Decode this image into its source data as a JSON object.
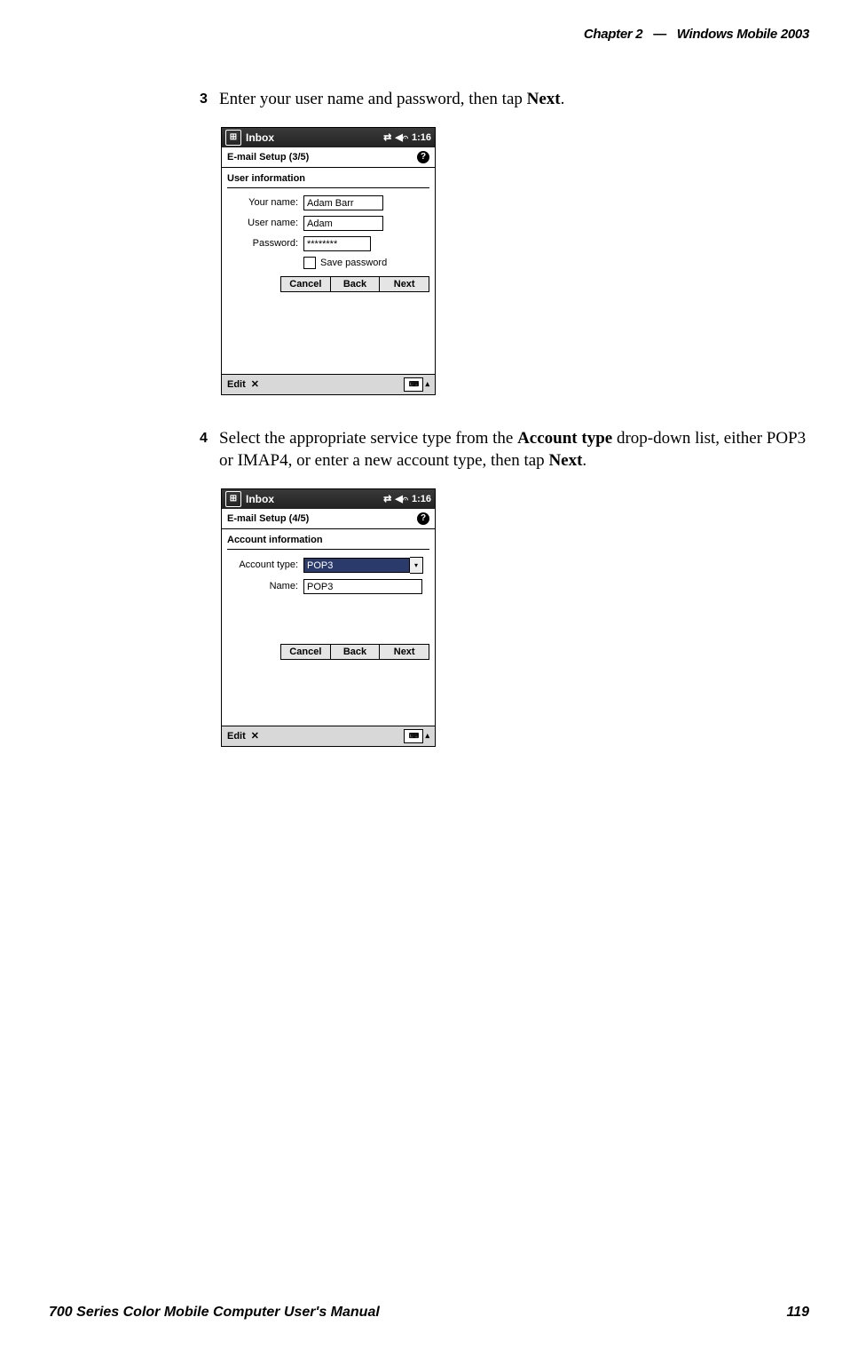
{
  "header": {
    "chapter": "Chapter",
    "num": "2",
    "sep": "—",
    "title": "Windows Mobile 2003"
  },
  "step3": {
    "num": "3",
    "text_a": "Enter your user name and password, then tap ",
    "bold": "Next",
    "text_b": "."
  },
  "step4": {
    "num": "4",
    "text_a": "Select the appropriate service type from the ",
    "bold1": "Account type",
    "text_b": " drop-down list, either POP3 or IMAP4, or enter a new account type, then tap ",
    "bold2": "Next",
    "text_c": "."
  },
  "device1": {
    "app": "Inbox",
    "time": "1:16",
    "subtitle": "E-mail Setup (3/5)",
    "section": "User information",
    "yourname_lbl": "Your name:",
    "yourname_val": "Adam Barr",
    "username_lbl": "User name:",
    "username_val": "Adam",
    "password_lbl": "Password:",
    "password_val": "********",
    "savepw": "Save password",
    "cancel": "Cancel",
    "back": "Back",
    "next": "Next",
    "edit": "Edit"
  },
  "device2": {
    "app": "Inbox",
    "time": "1:16",
    "subtitle": "E-mail Setup (4/5)",
    "section": "Account information",
    "accttype_lbl": "Account type:",
    "accttype_val": "POP3",
    "name_lbl": "Name:",
    "name_val": "POP3",
    "cancel": "Cancel",
    "back": "Back",
    "next": "Next",
    "edit": "Edit"
  },
  "footer": {
    "manual": "700 Series Color Mobile Computer User's Manual",
    "page": "119"
  }
}
